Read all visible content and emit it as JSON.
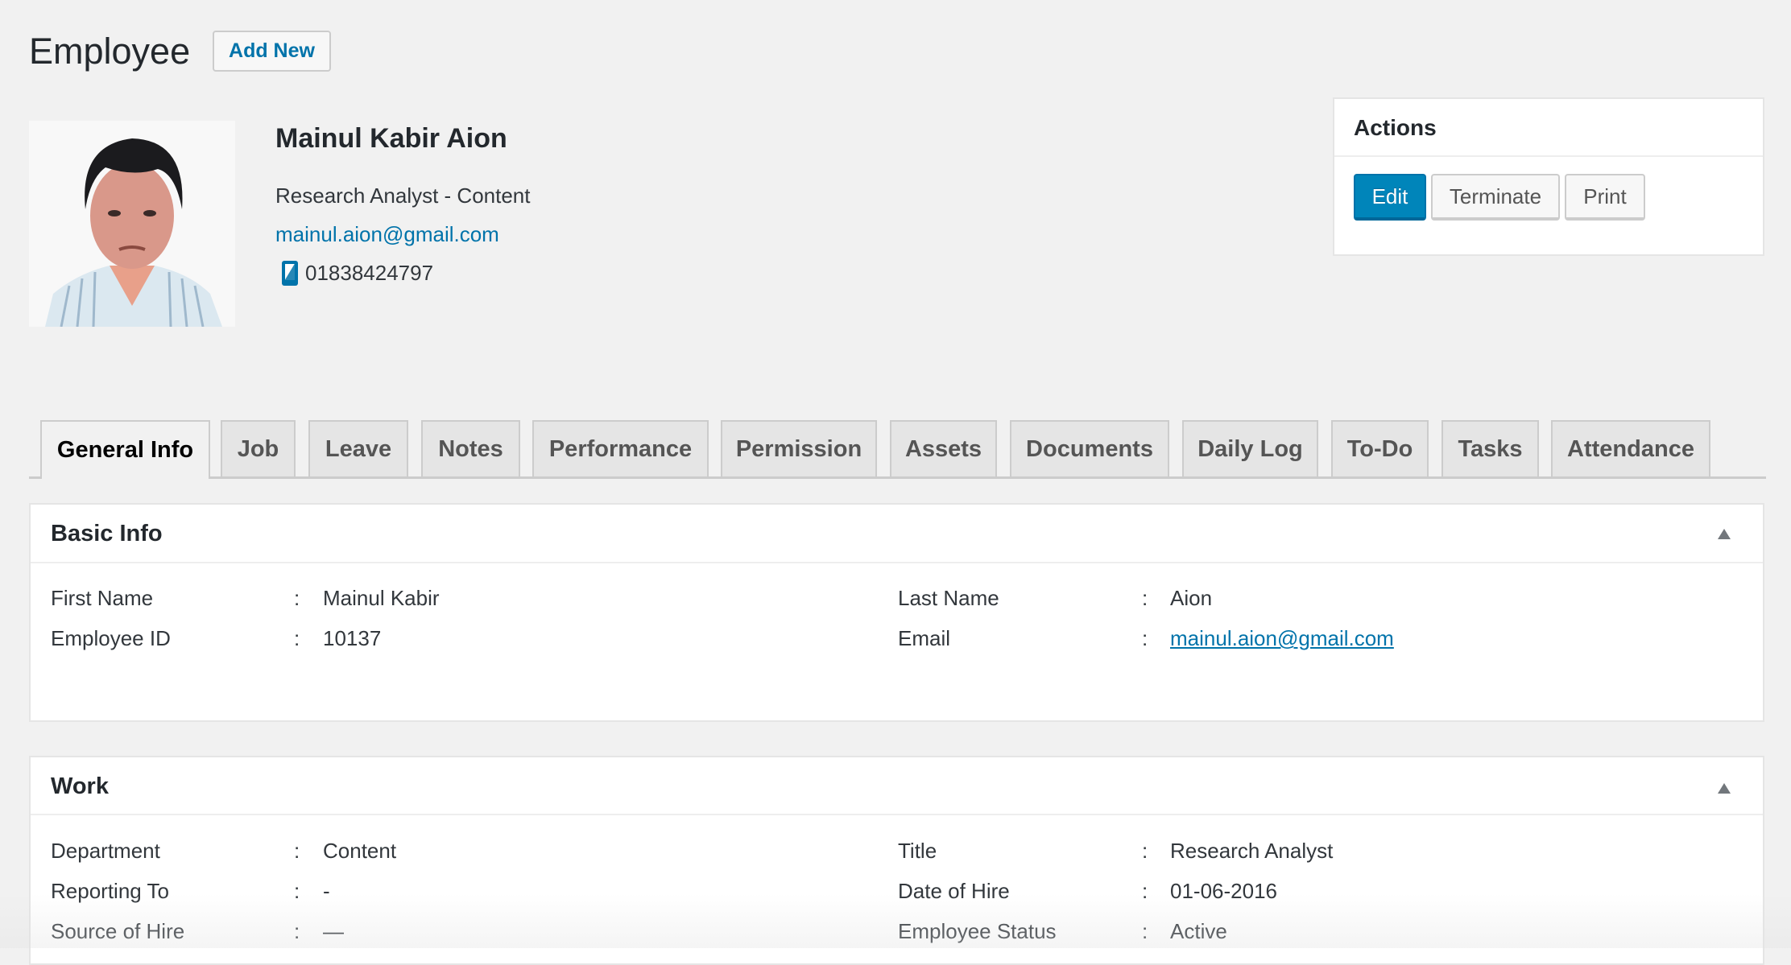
{
  "header": {
    "title": "Employee",
    "add_new_label": "Add New"
  },
  "employee": {
    "name": "Mainul Kabir Aion",
    "job": "Research Analyst - Content",
    "email": "mainul.aion@gmail.com",
    "phone": "01838424797",
    "photo_icon": "avatar-photo"
  },
  "actions": {
    "title": "Actions",
    "buttons": [
      "Edit",
      "Terminate",
      "Print"
    ],
    "accent": "#0085ba"
  },
  "tabs": [
    {
      "label": "General Info",
      "active": true
    },
    {
      "label": "Job"
    },
    {
      "label": "Leave"
    },
    {
      "label": "Notes"
    },
    {
      "label": "Performance"
    },
    {
      "label": "Permission"
    },
    {
      "label": "Assets"
    },
    {
      "label": "Documents"
    },
    {
      "label": "Daily Log"
    },
    {
      "label": "To-Do"
    },
    {
      "label": "Tasks"
    },
    {
      "label": "Attendance"
    }
  ],
  "basic_info": {
    "title": "Basic Info",
    "left": [
      {
        "label": "First Name",
        "value": "Mainul Kabir"
      },
      {
        "label": "Employee ID",
        "value": "10137"
      }
    ],
    "right": [
      {
        "label": "Last Name",
        "value": "Aion"
      },
      {
        "label": "Email",
        "value": "mainul.aion@gmail.com"
      }
    ]
  },
  "work": {
    "title": "Work",
    "left": [
      {
        "label": "Department",
        "value": "Content"
      },
      {
        "label": "Reporting To",
        "value": "-"
      },
      {
        "label": "Source of Hire",
        "value": "—"
      }
    ],
    "right": [
      {
        "label": "Title",
        "value": "Research Analyst"
      },
      {
        "label": "Date of Hire",
        "value": "01-06-2016"
      },
      {
        "label": "Employee Status",
        "value": "Active"
      }
    ]
  },
  "separator": ":"
}
